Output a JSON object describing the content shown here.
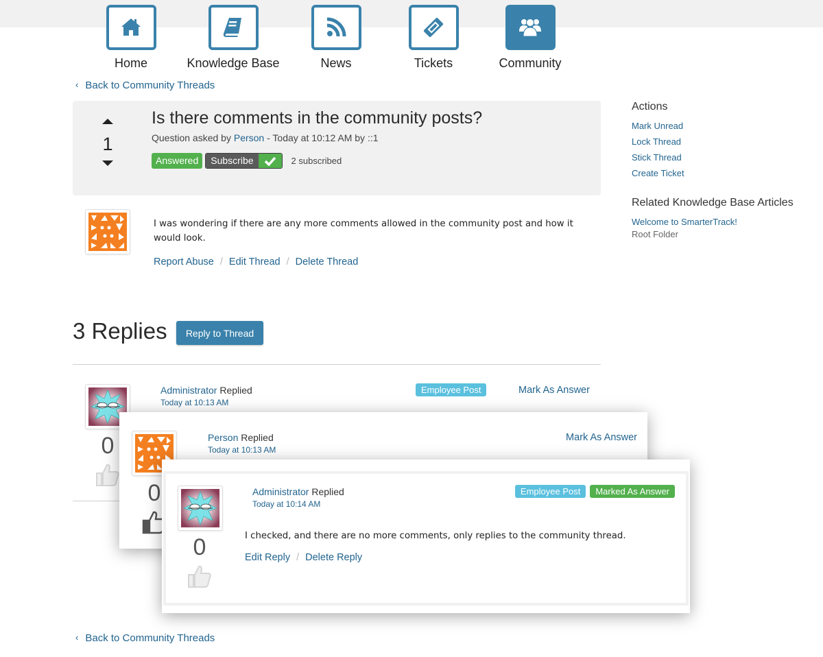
{
  "nav": {
    "items": [
      {
        "label": "Home",
        "icon": "home-icon",
        "active": false
      },
      {
        "label": "Knowledge Base",
        "icon": "book-icon",
        "active": false
      },
      {
        "label": "News",
        "icon": "rss-icon",
        "active": false
      },
      {
        "label": "Tickets",
        "icon": "ticket-icon",
        "active": false
      },
      {
        "label": "Community",
        "icon": "users-icon",
        "active": true
      }
    ]
  },
  "back_link": "Back to Community Threads",
  "question": {
    "votes": "1",
    "title": "Is there comments in the community posts?",
    "meta_prefix": "Question asked by",
    "author": "Person",
    "meta_suffix": "- Today at 10:12 AM by ::1",
    "status_badge": "Answered",
    "subscribe_label": "Subscribe",
    "subscribed_count": "2 subscribed",
    "body": "I was wondering if there are any more comments allowed in the community post and how it would look.",
    "actions": [
      "Report Abuse",
      "Edit Thread",
      "Delete Thread"
    ]
  },
  "sidebar": {
    "actions_heading": "Actions",
    "actions": [
      "Mark Unread",
      "Lock Thread",
      "Stick Thread",
      "Create Ticket"
    ],
    "related_heading": "Related Knowledge Base Articles",
    "related": [
      {
        "title": "Welcome to SmarterTrack!",
        "folder": "Root Folder"
      }
    ]
  },
  "replies": {
    "heading": "3 Replies",
    "reply_button": "Reply to Thread",
    "items": [
      {
        "author": "Administrator",
        "verb": "Replied",
        "time": "Today at 10:13 AM",
        "employee_badge": "Employee Post",
        "mark_answer": "Mark As Answer",
        "votes": "0"
      },
      {
        "author": "Person",
        "verb": "Replied",
        "time": "Today at 10:13 AM",
        "mark_answer": "Mark As Answer",
        "votes": "0"
      },
      {
        "author": "Administrator",
        "verb": "Replied",
        "time": "Today at 10:14 AM",
        "employee_badge": "Employee Post",
        "answer_badge": "Marked As Answer",
        "votes": "0",
        "body": "I checked, and there are no more comments, only replies to the community thread.",
        "actions": [
          "Edit Reply",
          "Delete Reply"
        ]
      }
    ]
  },
  "colors": {
    "brand": "#3a82ab",
    "link": "#22648f",
    "success": "#52b04d",
    "info": "#5bc0de"
  }
}
